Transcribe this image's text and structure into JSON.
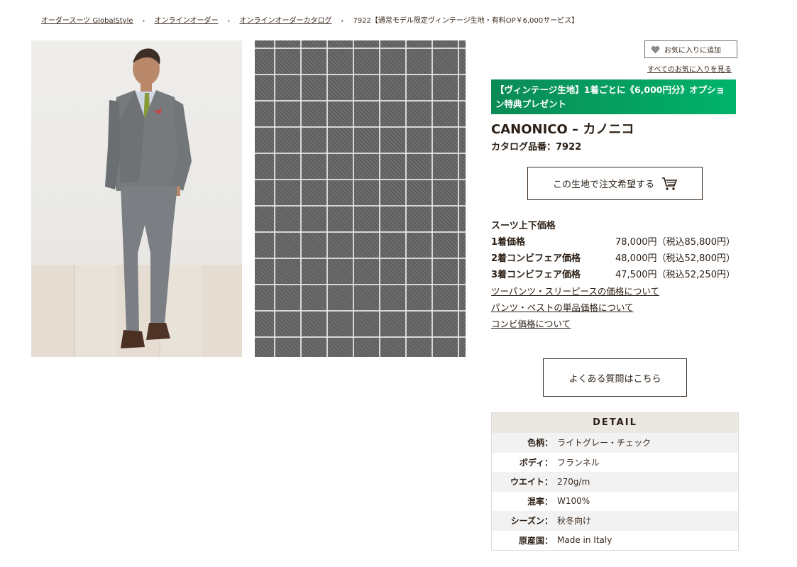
{
  "breadcrumb": [
    {
      "label": "オーダースーツ GlobalStyle",
      "link": true
    },
    {
      "label": "オンラインオーダー",
      "link": true
    },
    {
      "label": "オンラインオーダーカタログ",
      "link": true
    },
    {
      "label": "7922【通常モデル限定ヴィンテージ生地・有料OP￥6,000サービス】",
      "link": false
    }
  ],
  "favorite": {
    "add_label": "お気に入りに追加",
    "view_all_label": "すべてのお気に入りを見る"
  },
  "banner": {
    "text": "【ヴィンテージ生地】1着ごとに《6,000円分》オプション特典プレゼント"
  },
  "product": {
    "brand": "CANONICO – カノニコ",
    "catalog_no": "カタログ品番：7922"
  },
  "order_button": {
    "label": "この生地で注文希望する"
  },
  "prices": {
    "heading": "スーツ上下価格",
    "rows": [
      {
        "label": "1着価格",
        "value": "78,000円（税込85,800円）"
      },
      {
        "label": "2着コンビフェア価格",
        "value": "48,000円（税込52,800円）"
      },
      {
        "label": "3着コンビフェア価格",
        "value": "47,500円（税込52,250円）"
      }
    ],
    "links": [
      "ツーパンツ・スリーピースの価格について",
      "パンツ・ベストの単品価格について",
      "コンビ価格について"
    ]
  },
  "faq_button": {
    "label": "よくある質問はこちら"
  },
  "detail": {
    "heading": "DETAIL",
    "rows": [
      {
        "key": "色柄：",
        "value": "ライトグレー・チェック"
      },
      {
        "key": "ボディ：",
        "value": "フランネル"
      },
      {
        "key": "ウエイト：",
        "value": "270g/m"
      },
      {
        "key": "混率：",
        "value": "W100%"
      },
      {
        "key": "シーズン：",
        "value": "秋冬向け"
      },
      {
        "key": "原産国：",
        "value": "Made in Italy"
      }
    ]
  },
  "colors": {
    "banner_start": "#0b8a55",
    "banner_end": "#00b36b",
    "text": "#2a1e14"
  }
}
